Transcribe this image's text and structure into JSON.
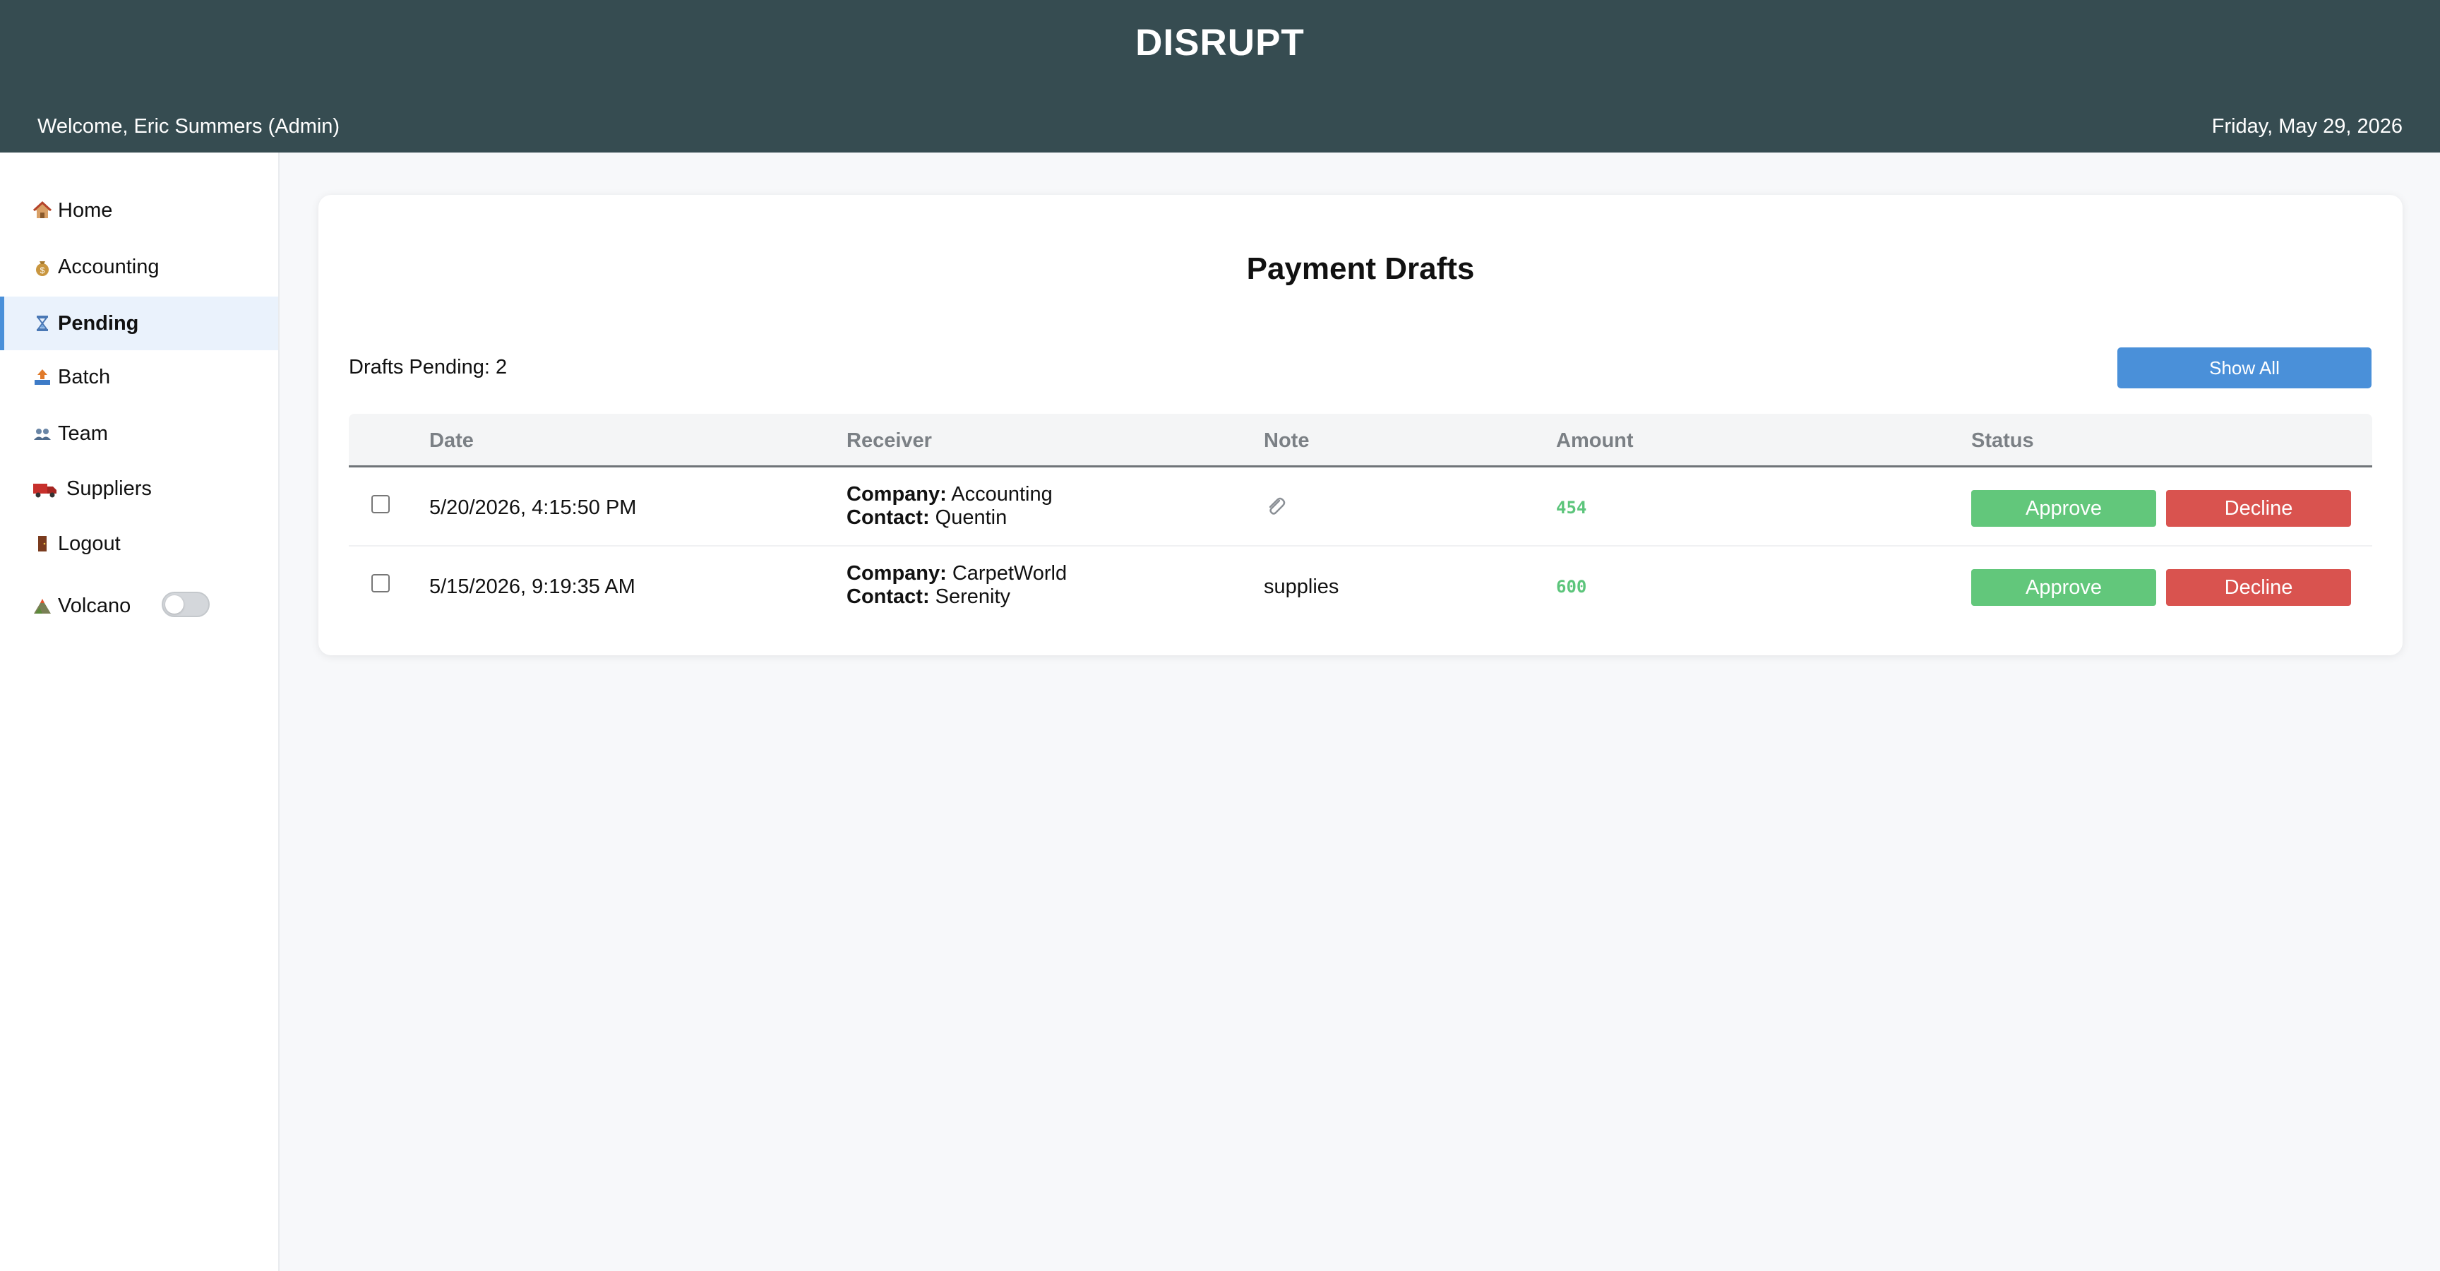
{
  "header": {
    "brand": "DISRUPT",
    "welcome": "Welcome, Eric Summers (Admin)",
    "date": "Friday, May 29, 2026",
    "background": "#364c51"
  },
  "sidebar": {
    "items": [
      {
        "label": "Home",
        "icon": "house-icon"
      },
      {
        "label": "Accounting",
        "icon": "money-bag-icon"
      },
      {
        "label": "Pending",
        "icon": "hourglass-icon",
        "active": true
      },
      {
        "label": "Batch",
        "icon": "upload-tray-icon"
      },
      {
        "label": "Team",
        "icon": "people-icon"
      },
      {
        "label": "Suppliers",
        "icon": "truck-icon"
      },
      {
        "label": "Logout",
        "icon": "door-icon"
      },
      {
        "label": "Volcano",
        "icon": "volcano-icon",
        "toggle": false
      }
    ],
    "accent": "#4a90d9"
  },
  "main": {
    "title": "Payment Drafts",
    "pending_count": "Drafts Pending: 2",
    "show_all_label": "Show All",
    "table": {
      "columns": [
        "Date",
        "Receiver",
        "Note",
        "Amount",
        "Status"
      ],
      "company_label": "Company:",
      "contact_label": "Contact:",
      "rows": [
        {
          "date": "5/20/2026, 4:15:50 PM",
          "company": "Accounting",
          "contact": "Quentin",
          "note": "",
          "note_icon": "paperclip-icon",
          "amount": "454",
          "approve_label": "Approve",
          "decline_label": "Decline"
        },
        {
          "date": "5/15/2026, 9:19:35 AM",
          "company": "CarpetWorld",
          "contact": "Serenity",
          "note": "supplies",
          "amount": "600",
          "approve_label": "Approve",
          "decline_label": "Decline"
        }
      ]
    },
    "colors": {
      "approve": "#62c77b",
      "decline": "#d9534f",
      "amount": "#5cc57b",
      "show_all": "#4a90d9"
    }
  }
}
